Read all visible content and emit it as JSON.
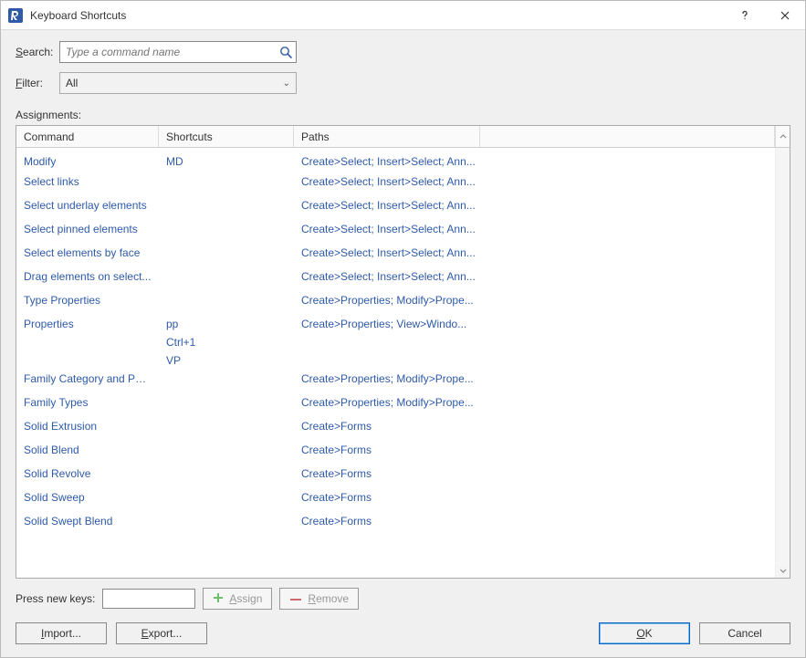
{
  "title": "Keyboard Shortcuts",
  "labels": {
    "search": "Search:",
    "filter": "Filter:",
    "assignments": "Assignments:",
    "press_new_keys": "Press new keys:"
  },
  "search": {
    "placeholder": "Type a command name",
    "value": ""
  },
  "filter": {
    "value": "All"
  },
  "columns": {
    "command": "Command",
    "shortcuts": "Shortcuts",
    "paths": "Paths"
  },
  "rows": [
    {
      "command": "Modify",
      "shortcuts": [
        "MD"
      ],
      "paths": "Create>Select; Insert>Select; Ann..."
    },
    {
      "command": "Select links",
      "shortcuts": [],
      "paths": "Create>Select; Insert>Select; Ann..."
    },
    {
      "command": "Select underlay elements",
      "shortcuts": [],
      "paths": "Create>Select; Insert>Select; Ann..."
    },
    {
      "command": "Select pinned elements",
      "shortcuts": [],
      "paths": "Create>Select; Insert>Select; Ann..."
    },
    {
      "command": "Select elements by face",
      "shortcuts": [],
      "paths": "Create>Select; Insert>Select; Ann..."
    },
    {
      "command": "Drag elements on select...",
      "shortcuts": [],
      "paths": "Create>Select; Insert>Select; Ann..."
    },
    {
      "command": "Type Properties",
      "shortcuts": [],
      "paths": "Create>Properties; Modify>Prope..."
    },
    {
      "command": "Properties",
      "shortcuts": [
        "pp",
        "Ctrl+1",
        "VP"
      ],
      "paths": "Create>Properties; View>Windo..."
    },
    {
      "command": "Family Category and Par...",
      "shortcuts": [],
      "paths": "Create>Properties; Modify>Prope..."
    },
    {
      "command": "Family Types",
      "shortcuts": [],
      "paths": "Create>Properties; Modify>Prope..."
    },
    {
      "command": "Solid Extrusion",
      "shortcuts": [],
      "paths": "Create>Forms"
    },
    {
      "command": "Solid Blend",
      "shortcuts": [],
      "paths": "Create>Forms"
    },
    {
      "command": "Solid Revolve",
      "shortcuts": [],
      "paths": "Create>Forms"
    },
    {
      "command": "Solid Sweep",
      "shortcuts": [],
      "paths": "Create>Forms"
    },
    {
      "command": "Solid Swept Blend",
      "shortcuts": [],
      "paths": "Create>Forms"
    }
  ],
  "buttons": {
    "assign": "Assign",
    "remove": "Remove",
    "import": "Import...",
    "export": "Export...",
    "ok": "OK",
    "cancel": "Cancel"
  },
  "new_keys": {
    "value": ""
  }
}
